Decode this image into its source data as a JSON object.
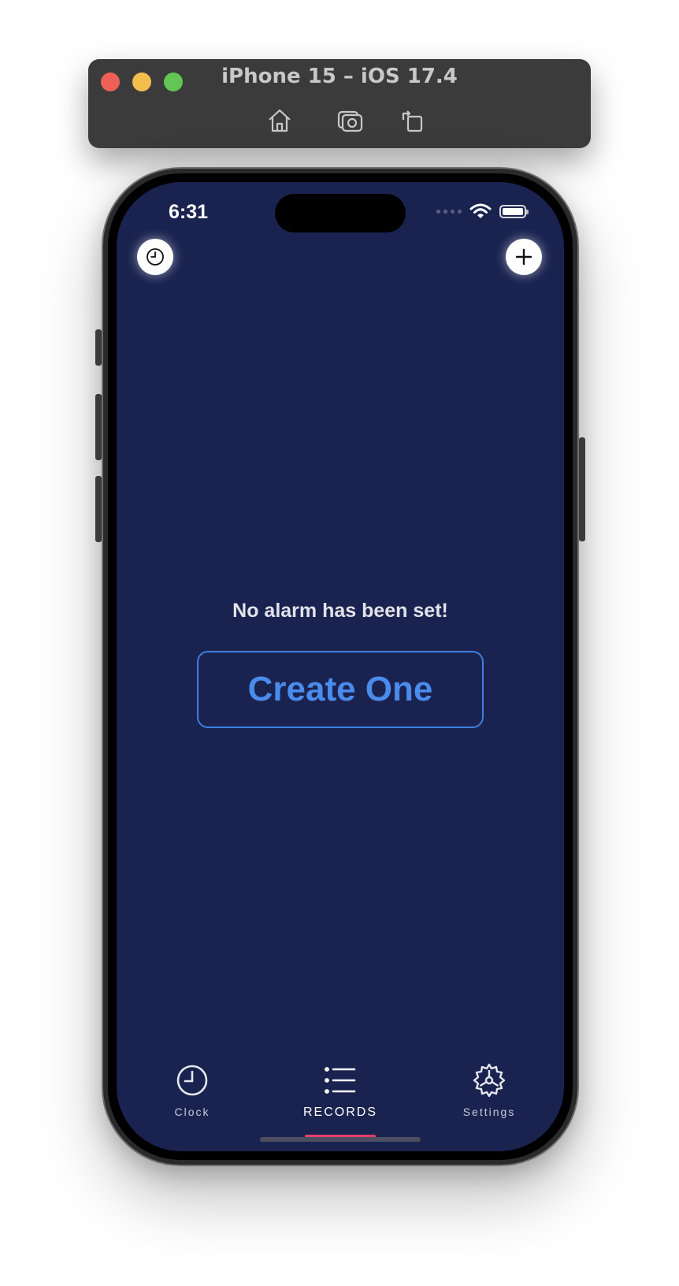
{
  "simulator": {
    "title": "iPhone 15 – iOS 17.4",
    "tools": [
      "home-icon",
      "screenshot-icon",
      "rotate-icon"
    ]
  },
  "status_bar": {
    "time": "6:31"
  },
  "header": {
    "left_button_icon": "clock-icon",
    "right_button_icon": "plus-icon"
  },
  "main": {
    "empty_message": "No alarm has been set!",
    "create_button_label": "Create One"
  },
  "tab_bar": {
    "tabs": [
      {
        "label": "Clock",
        "icon": "clock-icon",
        "active": false
      },
      {
        "label": "RECORDS",
        "icon": "list-icon",
        "active": true
      },
      {
        "label": "Settings",
        "icon": "gear-icon",
        "active": false
      }
    ]
  },
  "colors": {
    "screen_background": "#1a2350",
    "accent_blue": "#4a8bec",
    "active_indicator": "#e53e6b"
  }
}
